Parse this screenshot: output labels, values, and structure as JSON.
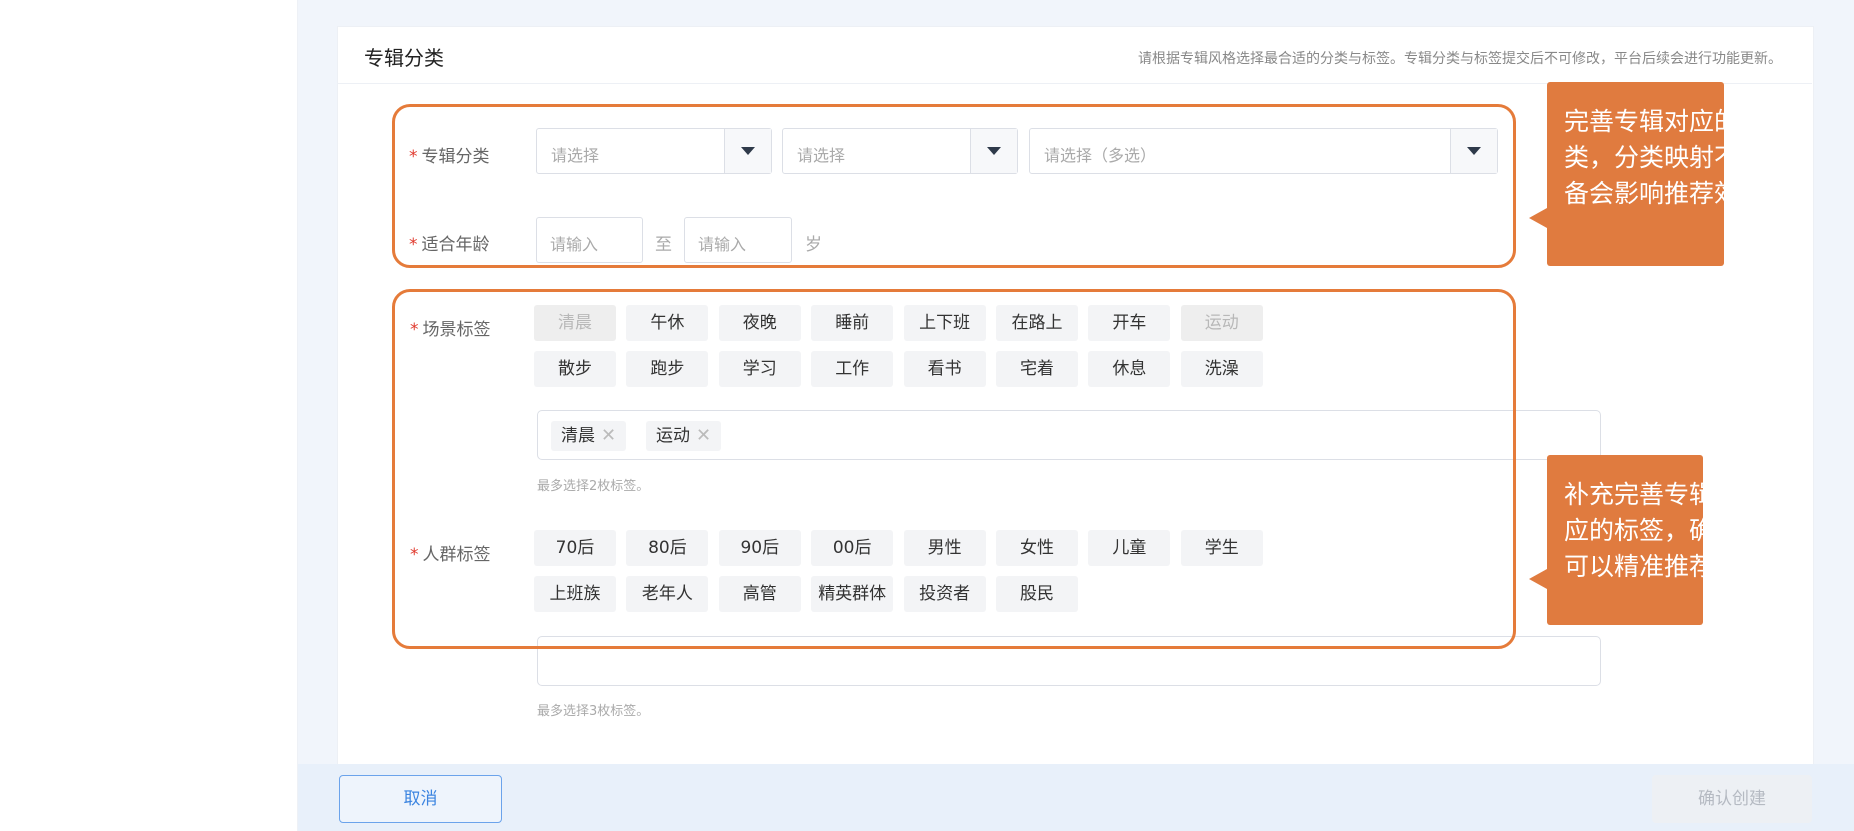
{
  "card": {
    "title": "专辑分类",
    "note": "请根据专辑风格选择最合适的分类与标签。专辑分类与标签提交后不可修改，平台后续会进行功能更新。"
  },
  "form": {
    "required_mark": "*",
    "category": {
      "label": "专辑分类",
      "select1_placeholder": "请选择",
      "select2_placeholder": "请选择",
      "select3_placeholder": "请选择（多选）"
    },
    "age": {
      "label": "适合年龄",
      "min_placeholder": "请输入",
      "to": "至",
      "max_placeholder": "请输入",
      "unit": "岁"
    },
    "scene": {
      "label": "场景标签",
      "tags": [
        "清晨",
        "午休",
        "夜晚",
        "睡前",
        "上下班",
        "在路上",
        "开车",
        "运动",
        "散步",
        "跑步",
        "学习",
        "工作",
        "看书",
        "宅着",
        "休息",
        "洗澡"
      ],
      "selected": [
        "清晨",
        "运动"
      ],
      "hint": "最多选择2枚标签。"
    },
    "crowd": {
      "label": "人群标签",
      "tags": [
        "70后",
        "80后",
        "90后",
        "00后",
        "男性",
        "女性",
        "儿童",
        "学生",
        "上班族",
        "老年人",
        "高管",
        "精英群体",
        "投资者",
        "股民"
      ],
      "selected": [],
      "hint": "最多选择3枚标签。"
    }
  },
  "callouts": {
    "top": [
      "完善专辑对应的分",
      "类，分类映射不准",
      "备会影响推荐效果"
    ],
    "bottom": [
      "补充完善专辑对",
      "应的标签，确保",
      "可以精准推荐"
    ]
  },
  "colors": {
    "accent_orange": "#e07b3f",
    "primary_blue": "#3b84e0",
    "required_red": "#e03a2e"
  },
  "footer": {
    "cancel_label": "取消",
    "confirm_label": "确认创建"
  }
}
